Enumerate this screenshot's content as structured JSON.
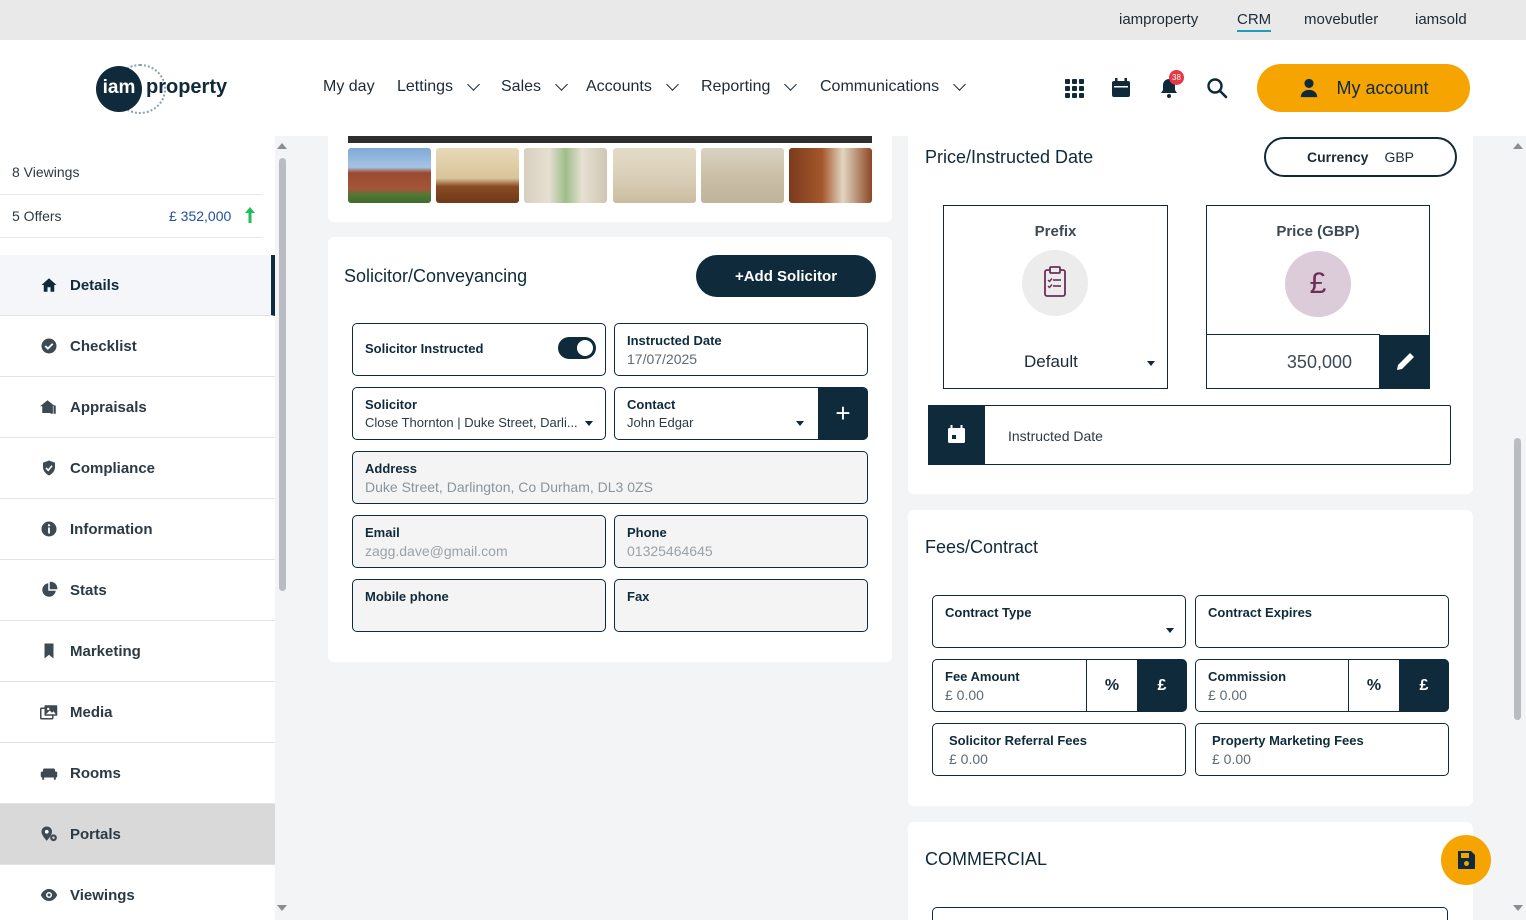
{
  "colors": {
    "navy": "#0f2a3a",
    "accent": "#f5a400",
    "active_link": "#1aa0b8",
    "offer_price": "#1f4fa5"
  },
  "brand_links": [
    "iamproperty",
    "CRM",
    "movebutler",
    "iamsold"
  ],
  "logo": {
    "circle_text": "iam",
    "word": "property"
  },
  "nav": {
    "items": [
      "My day",
      "Lettings",
      "Sales",
      "Accounts",
      "Reporting",
      "Communications"
    ],
    "notification_count": "38",
    "account_label": "My account"
  },
  "sidebar": {
    "viewings_summary": "8 Viewings",
    "offers_summary": "5 Offers",
    "offer_price": "£ 352,000",
    "items": [
      {
        "label": "Details",
        "icon": "home-icon"
      },
      {
        "label": "Checklist",
        "icon": "check-circle-icon"
      },
      {
        "label": "Appraisals",
        "icon": "house-chart-icon"
      },
      {
        "label": "Compliance",
        "icon": "shield-check-icon"
      },
      {
        "label": "Information",
        "icon": "info-icon"
      },
      {
        "label": "Stats",
        "icon": "pie-chart-icon"
      },
      {
        "label": "Marketing",
        "icon": "bookmark-icon"
      },
      {
        "label": "Media",
        "icon": "images-icon"
      },
      {
        "label": "Rooms",
        "icon": "sofa-icon"
      },
      {
        "label": "Portals",
        "icon": "portal-gear-icon"
      },
      {
        "label": "Viewings",
        "icon": "eye-icon"
      }
    ]
  },
  "solicitor": {
    "title": "Solicitor/Conveyancing",
    "add_button": "+Add Solicitor",
    "instructed_toggle_label": "Solicitor Instructed",
    "instructed_date_label": "Instructed Date",
    "instructed_date_value": "17/07/2025",
    "solicitor_label": "Solicitor",
    "solicitor_value": "Close Thornton | Duke Street, Darli...",
    "contact_label": "Contact",
    "contact_value": "John Edgar",
    "address_label": "Address",
    "address_value": "Duke Street, Darlington, Co Durham, DL3 0ZS",
    "email_label": "Email",
    "email_value": "zagg.dave@gmail.com",
    "phone_label": "Phone",
    "phone_value": "01325464645",
    "mobile_label": "Mobile phone",
    "fax_label": "Fax"
  },
  "price": {
    "title": "Price/Instructed Date",
    "currency_label": "Currency",
    "currency_value": "GBP",
    "prefix_label": "Prefix",
    "prefix_value": "Default",
    "price_label": "Price (GBP)",
    "price_symbol": "£",
    "price_value": "350,000",
    "instructed_date_label": "Instructed Date"
  },
  "fees": {
    "title": "Fees/Contract",
    "contract_type_label": "Contract Type",
    "contract_expires_label": "Contract Expires",
    "fee_amount_label": "Fee Amount",
    "fee_amount_value": "£ 0.00",
    "commission_label": "Commission",
    "commission_value": "£ 0.00",
    "percent_symbol": "%",
    "pound_symbol": "£",
    "solicitor_referral_label": "Solicitor Referral Fees",
    "solicitor_referral_value": "£ 0.00",
    "property_marketing_label": "Property Marketing Fees",
    "property_marketing_value": "£ 0.00"
  },
  "commercial": {
    "title": "COMMERCIAL"
  }
}
